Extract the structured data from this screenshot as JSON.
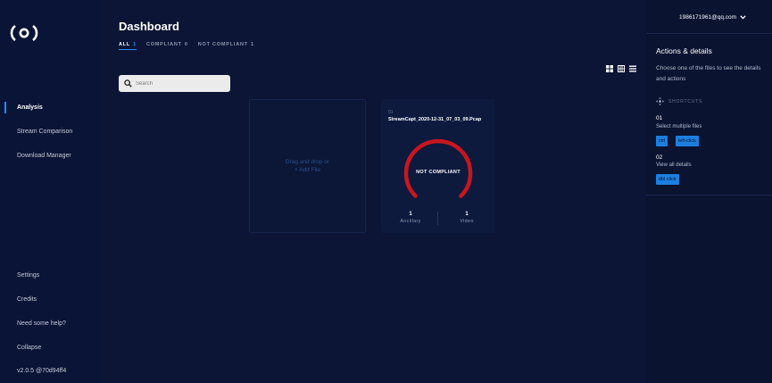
{
  "sidebar": {
    "logo": "logo-icon",
    "items": [
      {
        "label": "Analysis",
        "active": true
      },
      {
        "label": "Stream Comparison"
      },
      {
        "label": "Download Manager"
      }
    ],
    "bottom_items": [
      {
        "label": "Settings"
      },
      {
        "label": "Credits"
      },
      {
        "label": "Need some help?"
      },
      {
        "label": "Collapse"
      }
    ],
    "version": "v2.0.5 @70d94ff4"
  },
  "main": {
    "title": "Dashboard",
    "filters": [
      {
        "label": "ALL",
        "count": "1",
        "active": true
      },
      {
        "label": "COMPLIANT",
        "count": "0"
      },
      {
        "label": "NOT COMPLIANT",
        "count": "1"
      }
    ],
    "search": {
      "placeholder": "Search"
    },
    "view_icons": [
      "large-grid-icon",
      "small-grid-icon",
      "list-icon"
    ],
    "dropzone": {
      "line1": "Drag and drop or",
      "line2": "+ Add File"
    },
    "file_card": {
      "index": "01",
      "filename": "StreamCapt_2020-12-31_07_03_09.Pcap",
      "status": "NOT COMPLIANT",
      "stats": [
        {
          "value": "1",
          "label": "Ancillary"
        },
        {
          "value": "1",
          "label": "Video"
        }
      ]
    }
  },
  "right_panel": {
    "user": "1986171961@qq.com",
    "title": "Actions & details",
    "description": "Choose one of the files to see the details and actions",
    "shortcuts_label": "SHORTCUTS",
    "shortcuts": [
      {
        "num": "01",
        "text": "Select multiple files",
        "keys": [
          "ctrl",
          "left-click"
        ]
      },
      {
        "num": "02",
        "text": "View all details",
        "keys": [
          "dbl click"
        ]
      }
    ]
  },
  "colors": {
    "background": "#0c1535",
    "accent": "#2f86ff",
    "not_compliant": "#c8161d",
    "key_badge": "#1c7fe0"
  }
}
